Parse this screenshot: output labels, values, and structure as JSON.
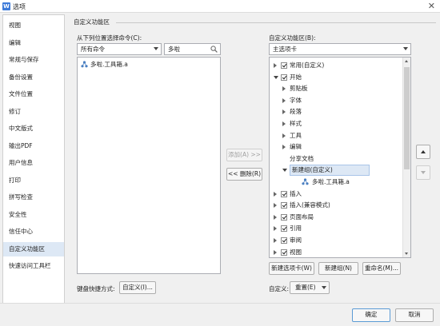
{
  "window": {
    "title": "选项",
    "app_icon_glyph": "W"
  },
  "sidebar": {
    "items": [
      {
        "label": "视图"
      },
      {
        "label": "编辑"
      },
      {
        "label": "常规与保存"
      },
      {
        "label": "备份设置"
      },
      {
        "label": "文件位置"
      },
      {
        "label": "修订"
      },
      {
        "label": "中文版式"
      },
      {
        "label": "输出PDF"
      },
      {
        "label": "用户信息"
      },
      {
        "label": "打印"
      },
      {
        "label": "拼写检查"
      },
      {
        "label": "安全性"
      },
      {
        "label": "信任中心"
      },
      {
        "label": "自定义功能区"
      },
      {
        "label": "快速访问工具栏"
      }
    ],
    "active_index": 13
  },
  "main": {
    "section_title": "自定义功能区",
    "left": {
      "choose_label": "从下列位置选择命令(C):",
      "command_source": "所有命令",
      "search_value": "多啦",
      "items": [
        {
          "label": "多啦.工具箱.a",
          "icon": "addin-icon"
        }
      ]
    },
    "middle": {
      "add_label": "添加(A) >>",
      "remove_label": "<< 删除(R)"
    },
    "right": {
      "customize_label": "自定义功能区(B):",
      "tab_type": "主选项卡",
      "tree": [
        {
          "label": "常用(自定义)",
          "level": 0,
          "expander": "right",
          "checked": true
        },
        {
          "label": "开始",
          "level": 0,
          "expander": "down",
          "checked": true
        },
        {
          "label": "剪贴板",
          "level": 1,
          "expander": "right"
        },
        {
          "label": "字体",
          "level": 1,
          "expander": "right"
        },
        {
          "label": "段落",
          "level": 1,
          "expander": "right"
        },
        {
          "label": "样式",
          "level": 1,
          "expander": "right"
        },
        {
          "label": "工具",
          "level": 1,
          "expander": "right"
        },
        {
          "label": "编辑",
          "level": 1,
          "expander": "right"
        },
        {
          "label": "分享文档",
          "level": 1,
          "expander": "none"
        },
        {
          "label": "新建组(自定义)",
          "level": 1,
          "expander": "down",
          "selected": true
        },
        {
          "label": "多啦.工具箱.a",
          "level": 2,
          "expander": "none",
          "icon": "addin-icon"
        },
        {
          "label": "插入",
          "level": 0,
          "expander": "right",
          "checked": true
        },
        {
          "label": "插入(兼容模式)",
          "level": 0,
          "expander": "right",
          "checked": true
        },
        {
          "label": "页面布局",
          "level": 0,
          "expander": "right",
          "checked": true
        },
        {
          "label": "引用",
          "level": 0,
          "expander": "right",
          "checked": true
        },
        {
          "label": "审阅",
          "level": 0,
          "expander": "right",
          "checked": true
        },
        {
          "label": "视图",
          "level": 0,
          "expander": "right",
          "checked": true
        }
      ],
      "new_tab_label": "新建选项卡(W)",
      "new_group_label": "新建组(N)",
      "rename_label": "重命名(M)...",
      "customize_short_label": "自定义:",
      "reset_label": "重置(E)"
    },
    "keyboard_label": "键盘快捷方式:",
    "keyboard_button": "自定义(I)..."
  },
  "footer": {
    "ok_label": "确定",
    "cancel_label": "取消"
  },
  "colors": {
    "accent": "#3d7bd9",
    "selection": "#dde8f5"
  }
}
